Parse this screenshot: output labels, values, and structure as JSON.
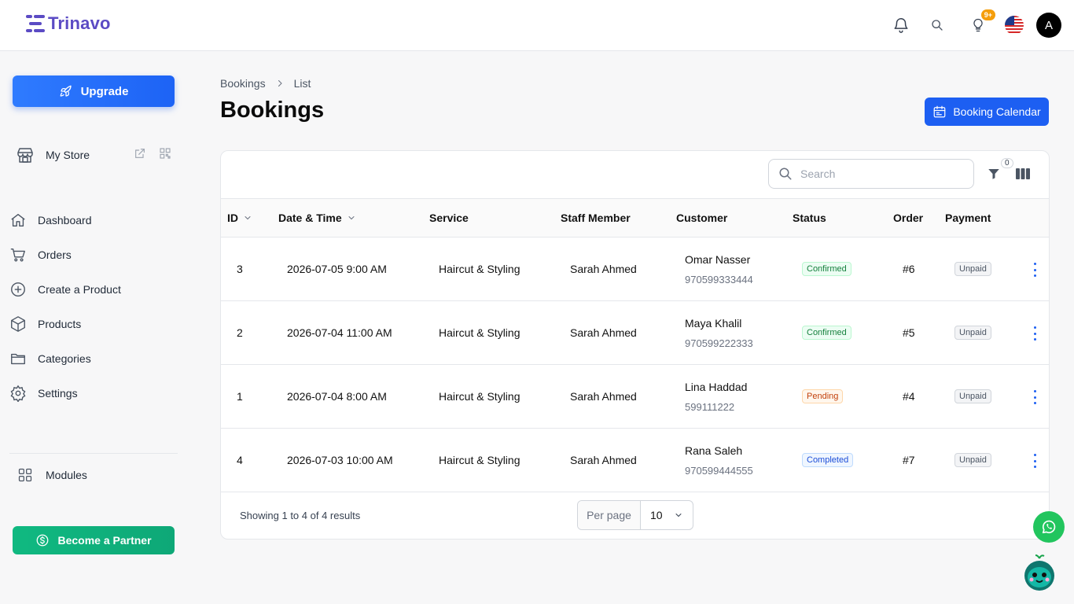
{
  "brand": {
    "name": "Trinavo",
    "color": "#5b4bc4"
  },
  "header": {
    "notifications_badge": "9+",
    "avatar_initial": "A",
    "flag": "us-flag-icon"
  },
  "sidebar": {
    "upgrade_label": "Upgrade",
    "store_label": "My Store",
    "items": [
      {
        "label": "Dashboard",
        "icon": "home-icon"
      },
      {
        "label": "Orders",
        "icon": "cart-icon"
      },
      {
        "label": "Create a Product",
        "icon": "plus-circle-icon"
      },
      {
        "label": "Products",
        "icon": "box-icon"
      },
      {
        "label": "Categories",
        "icon": "folder-icon"
      },
      {
        "label": "Settings",
        "icon": "gear-icon"
      }
    ],
    "modules_label": "Modules",
    "partner_label": "Become a Partner"
  },
  "breadcrumb": {
    "root": "Bookings",
    "current": "List"
  },
  "page": {
    "title": "Bookings",
    "calendar_button": "Booking Calendar"
  },
  "toolbar": {
    "search_placeholder": "Search",
    "filter_count": "0"
  },
  "table": {
    "columns": [
      "ID",
      "Date & Time",
      "Service",
      "Staff Member",
      "Customer",
      "Status",
      "Order",
      "Payment"
    ],
    "rows": [
      {
        "id": "3",
        "datetime": "2026-07-05 9:00 AM",
        "service": "Haircut & Styling",
        "staff": "Sarah Ahmed",
        "customer": "Omar Nasser",
        "phone": "970599333444",
        "status": "Confirmed",
        "order": "#6",
        "payment": "Unpaid"
      },
      {
        "id": "2",
        "datetime": "2026-07-04 11:00 AM",
        "service": "Haircut & Styling",
        "staff": "Sarah Ahmed",
        "customer": "Maya Khalil",
        "phone": "970599222333",
        "status": "Confirmed",
        "order": "#5",
        "payment": "Unpaid"
      },
      {
        "id": "1",
        "datetime": "2026-07-04 8:00 AM",
        "service": "Haircut & Styling",
        "staff": "Sarah Ahmed",
        "customer": "Lina Haddad",
        "phone": "599111222",
        "status": "Pending",
        "order": "#4",
        "payment": "Unpaid"
      },
      {
        "id": "4",
        "datetime": "2026-07-03 10:00 AM",
        "service": "Haircut & Styling",
        "staff": "Sarah Ahmed",
        "customer": "Rana Saleh",
        "phone": "970599444555",
        "status": "Completed",
        "order": "#7",
        "payment": "Unpaid"
      }
    ]
  },
  "pagination": {
    "summary": "Showing 1 to 4 of 4 results",
    "per_page_label": "Per page",
    "per_page_value": "10"
  },
  "colors": {
    "primary": "#1d5ff2",
    "partner": "#10b981",
    "confirmed": "#15803d",
    "pending": "#c2410c",
    "completed": "#1d4ed8"
  }
}
